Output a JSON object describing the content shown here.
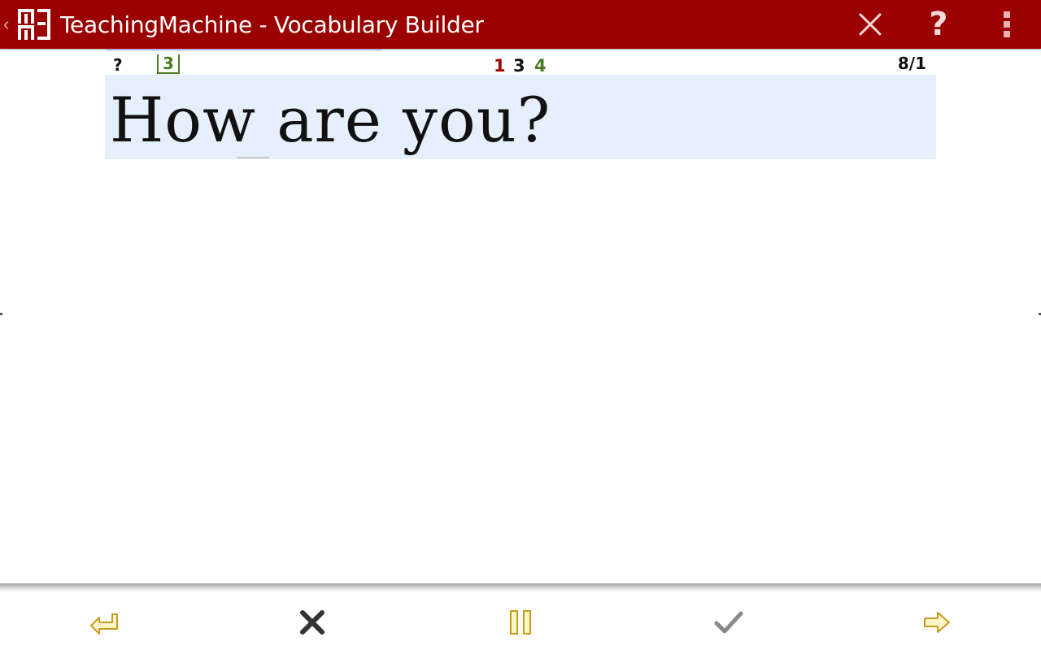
{
  "app": {
    "title": "TeachingMachine - Vocabulary Builder",
    "logo_icon": "teachingmachine-logo-icon",
    "brand_color": "#9b0000"
  },
  "actionbar": {
    "close_icon": "close-icon",
    "help_label": "?",
    "overflow_icon": "overflow-menu-icon"
  },
  "status": {
    "hint": "?",
    "box_level": "3",
    "wrong_count": "1",
    "neutral_count": "3",
    "right_count": "4",
    "progress": "8/1"
  },
  "card": {
    "question": "How are you?",
    "background": "#e6f0fc"
  },
  "toolbar": {
    "back_icon": "back-arrow-icon",
    "wrong_icon": "wrong-x-icon",
    "pause_icon": "pause-icon",
    "right_icon": "checkmark-icon",
    "next_icon": "next-arrow-icon"
  }
}
